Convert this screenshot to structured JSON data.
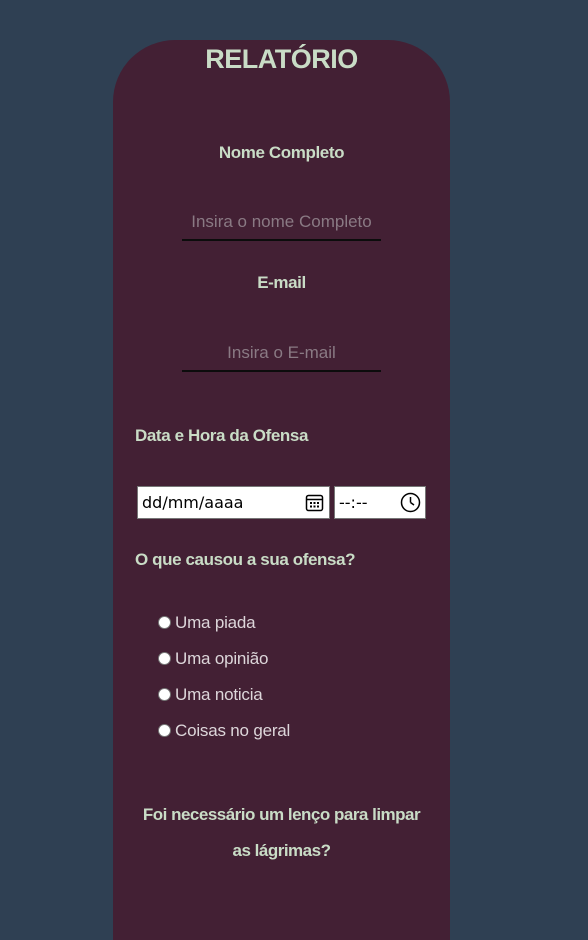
{
  "form": {
    "title": "RELATÓRIO",
    "name": {
      "label": "Nome Completo",
      "placeholder": "Insira o nome Completo",
      "value": ""
    },
    "email": {
      "label": "E-mail",
      "placeholder": "Insira o E-mail",
      "value": ""
    },
    "datetime": {
      "label": "Data e Hora da Ofensa",
      "date_placeholder": "dd/mm/aaaa",
      "time_placeholder": "--:--"
    },
    "offense": {
      "question": "O que causou a sua ofensa?",
      "options": [
        {
          "label": "Uma piada",
          "checked": false
        },
        {
          "label": "Uma opinião",
          "checked": false
        },
        {
          "label": "Uma noticia",
          "checked": false
        },
        {
          "label": "Coisas no geral",
          "checked": false
        }
      ]
    },
    "tissue_question": "Foi necessário um lenço para limpar as lágrimas?"
  },
  "colors": {
    "page_background": "#2f4053",
    "card_background": "#432034",
    "label_text": "#c9dcc6",
    "input_underline": "#0c0c0c"
  },
  "icons": {
    "date": "calendar-icon",
    "time": "clock-icon"
  }
}
